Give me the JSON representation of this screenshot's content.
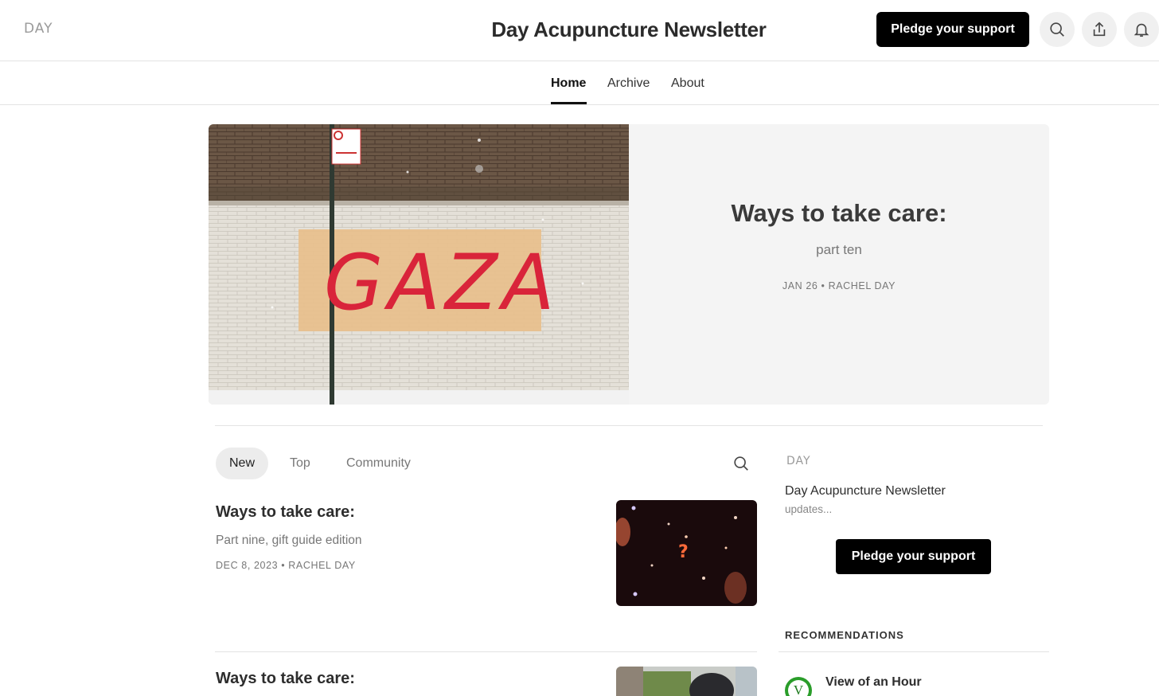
{
  "header": {
    "logo_text": "DAY",
    "title": "Day Acupuncture Newsletter",
    "pledge_label": "Pledge your support",
    "icons": [
      "search-icon",
      "share-icon",
      "bell-icon"
    ]
  },
  "nav": {
    "items": [
      {
        "label": "Home",
        "active": true
      },
      {
        "label": "Archive",
        "active": false
      },
      {
        "label": "About",
        "active": false
      }
    ]
  },
  "hero": {
    "image_text": "GAZA",
    "title": "Ways to take care:",
    "subtitle": "part ten",
    "meta": "JAN 26 • RACHEL DAY"
  },
  "tabs": {
    "items": [
      {
        "label": "New",
        "active": true
      },
      {
        "label": "Top",
        "active": false
      },
      {
        "label": "Community",
        "active": false
      }
    ]
  },
  "posts": [
    {
      "title": "Ways to take care:",
      "subtitle": "Part nine, gift guide edition",
      "meta": "DEC 8, 2023 • RACHEL DAY"
    },
    {
      "title": "Ways to take care:"
    }
  ],
  "sidebar": {
    "logo_text": "DAY",
    "name": "Day Acupuncture Newsletter",
    "description": "updates...",
    "pledge_label": "Pledge your support",
    "recommendations_heading": "RECOMMENDATIONS",
    "recommendations": [
      {
        "avatar_letter": "V",
        "name": "View of an Hour"
      }
    ]
  },
  "colors": {
    "accent": "#000000",
    "graffiti": "#d9243a",
    "rec_avatar": "#2a9d2a"
  }
}
